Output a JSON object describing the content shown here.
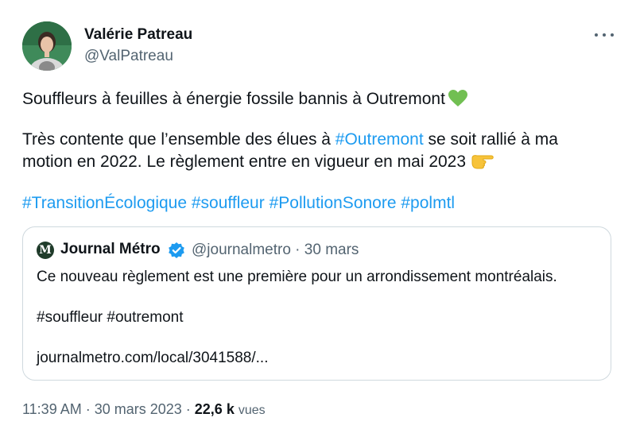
{
  "author": {
    "name": "Valérie Patreau",
    "handle": "@ValPatreau"
  },
  "tweet": {
    "line1": "Souffleurs à feuilles à énergie fossile bannis à Outremont",
    "line1_emoji": "green-heart",
    "line2_before": "Très contente que l’ensemble des élues à ",
    "line2_tag": "#Outremont",
    "line2_after": " se soit rallié à ma",
    "line3": "motion en 2022. Le règlement entre en vigueur en mai 2023",
    "line3_emoji": "pointing-hand",
    "hashtags": [
      "#TransitionÉcologique",
      "#souffleur",
      "#PollutionSonore",
      "#polmtl"
    ]
  },
  "quote": {
    "logo_letter": "M",
    "name": "Journal Métro",
    "meta": "@journalmetro · 30 mars",
    "text": "Ce nouveau règlement est une première pour un arrondissement montréalais.",
    "tags": "#souffleur #outremont",
    "link": "journalmetro.com/local/3041588/..."
  },
  "footer": {
    "time_date": "11:39 AM · 30 mars 2023 · ",
    "views_count": "22,6 k",
    "views_label": "vues"
  },
  "colors": {
    "accent": "#1d9bf0",
    "verified": "#1d9bf0",
    "secondary_text": "#536471",
    "heart": "#71bf52"
  }
}
